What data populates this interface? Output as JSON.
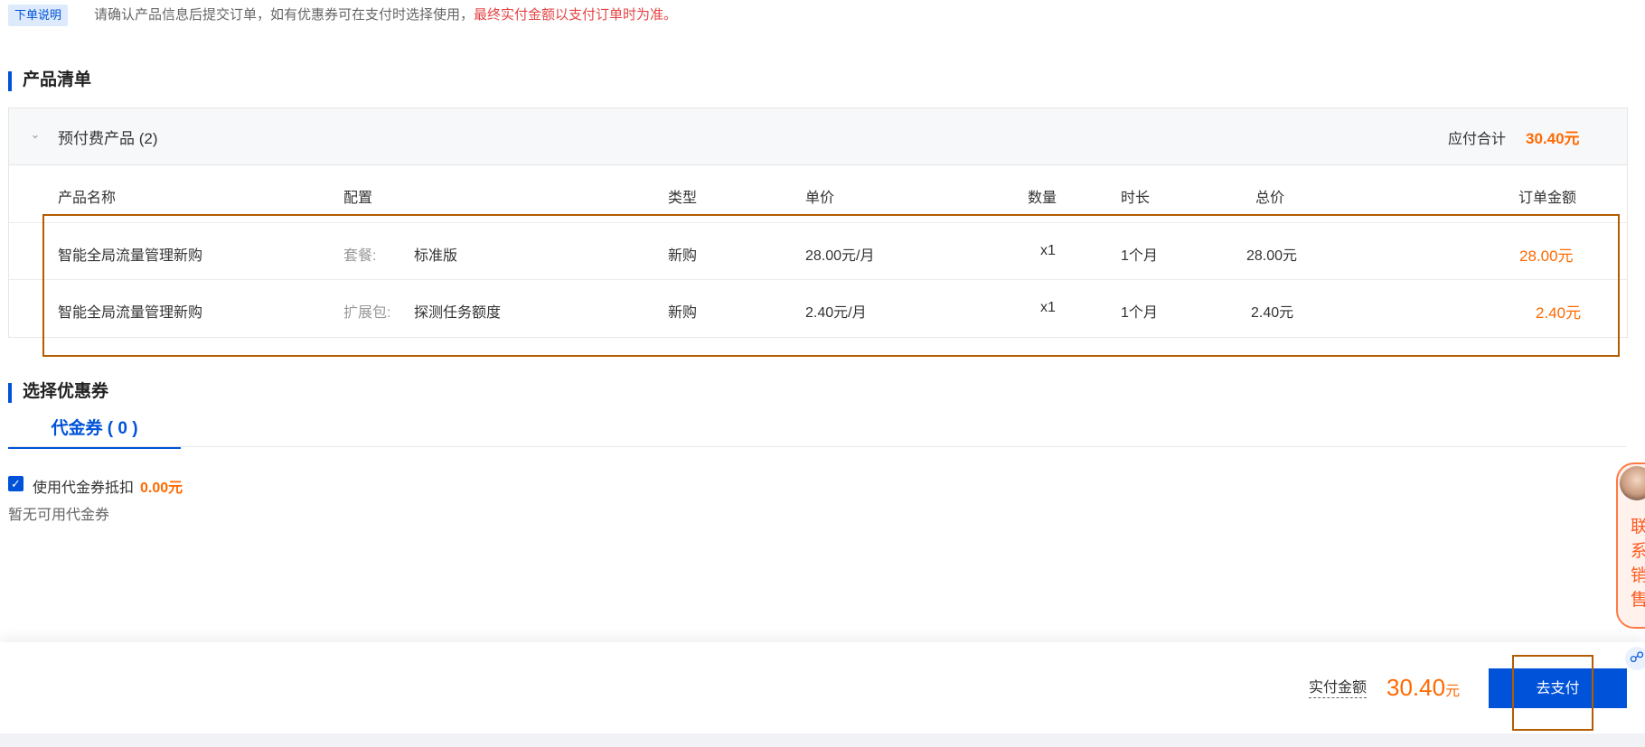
{
  "notice": {
    "tag": "下单说明",
    "text": "请确认产品信息后提交订单，如有优惠券可在支付时选择使用，",
    "warning": "最终实付金额以支付订单时为准。"
  },
  "product_section": {
    "title": "产品清单",
    "group": {
      "title": "预付费产品 (2)",
      "total_label": "应付合计",
      "total_value": "30.40元"
    },
    "columns": [
      "产品名称",
      "配置",
      "类型",
      "单价",
      "数量",
      "时长",
      "总价",
      "订单金额"
    ],
    "rows": [
      {
        "name": "智能全局流量管理新购",
        "config_key": "套餐:",
        "config_value": "标准版",
        "type": "新购",
        "unit_price": "28.00元/月",
        "qty": "x1",
        "duration": "1个月",
        "total": "28.00元",
        "order_amount": "28.00元"
      },
      {
        "name": "智能全局流量管理新购",
        "config_key": "扩展包:",
        "config_value": "探测任务额度",
        "type": "新购",
        "unit_price": "2.40元/月",
        "qty": "x1",
        "duration": "1个月",
        "total": "2.40元",
        "order_amount": "2.40元"
      }
    ]
  },
  "coupon_section": {
    "title": "选择优惠券",
    "tab_label": "代金券 ( 0 )",
    "use_label": "使用代金券抵扣",
    "use_value": "0.00元",
    "empty_text": "暂无可用代金券"
  },
  "footer": {
    "pay_label": "实付金额",
    "pay_amount": "30.40",
    "pay_unit": "元",
    "pay_button": "去支付"
  },
  "side_widget": {
    "text": "联系销售"
  },
  "colors": {
    "primary": "#0052d9",
    "accent_orange": "#ff6a00",
    "warning_red": "#e54545",
    "highlight_box": "#b35c00"
  }
}
